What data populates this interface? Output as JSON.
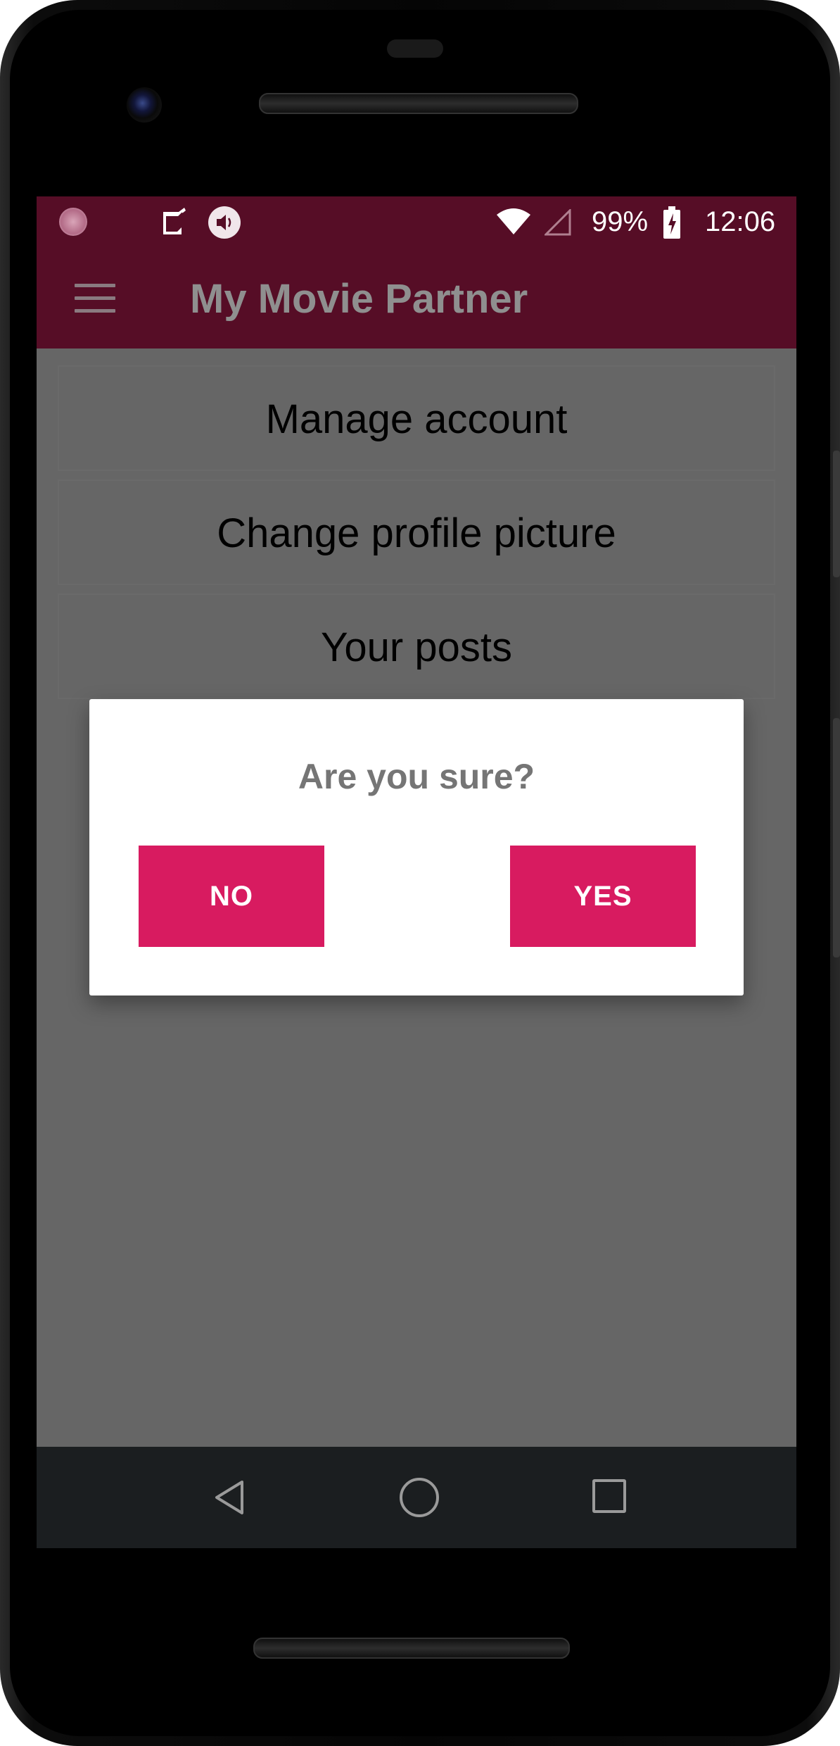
{
  "status_bar": {
    "battery_percent": "99%",
    "time": "12:06",
    "icons": [
      "notification-circle-icon",
      "checklist-icon",
      "volume-icon",
      "wifi-icon",
      "signal-icon",
      "battery-charging-icon"
    ]
  },
  "app_bar": {
    "title": "My Movie Partner",
    "menu_icon": "hamburger-menu-icon"
  },
  "menu_list": {
    "items": [
      {
        "label": "Manage account"
      },
      {
        "label": "Change profile picture"
      },
      {
        "label": "Your posts"
      }
    ]
  },
  "dialog": {
    "title": "Are you sure?",
    "no_label": "NO",
    "yes_label": "YES"
  },
  "nav_bar": {
    "icons": [
      "back-icon",
      "home-icon",
      "recents-icon"
    ]
  },
  "colors": {
    "app_bar": "#560d26",
    "accent_button": "#d81b60",
    "scrim": "#666666",
    "nav_bar": "#1b1e20"
  }
}
